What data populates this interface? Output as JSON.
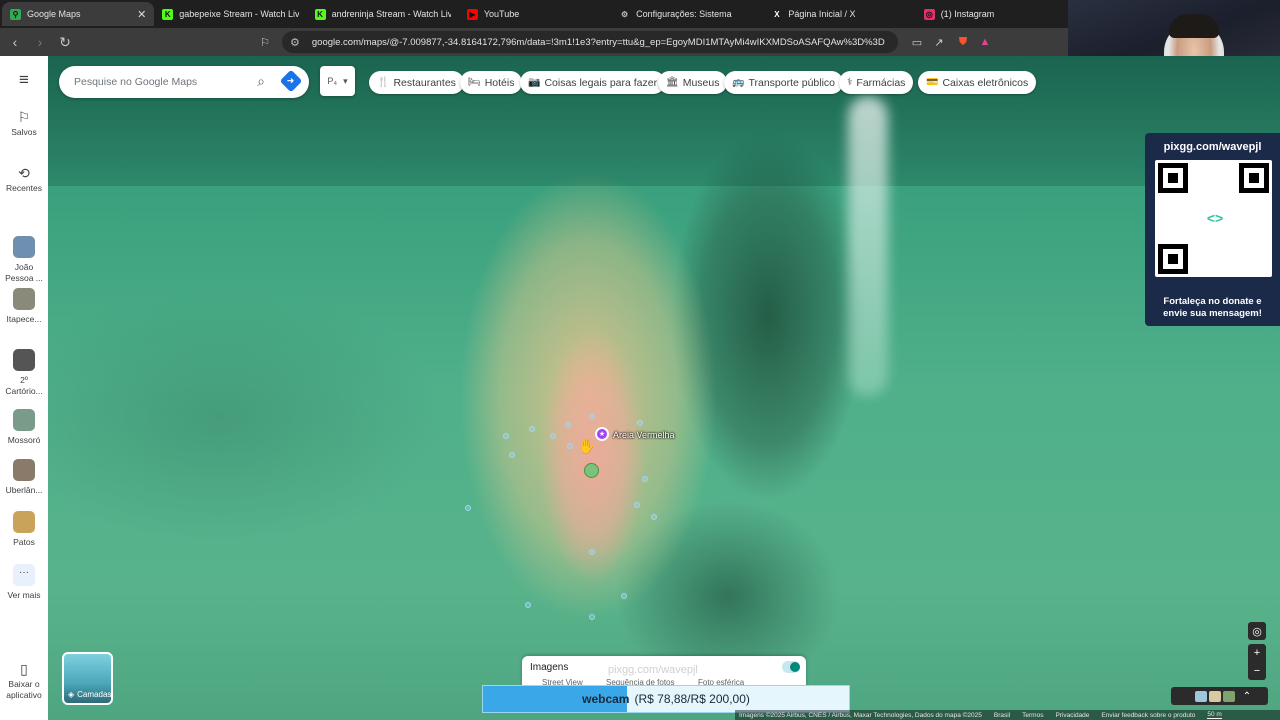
{
  "tabs": [
    {
      "title": "Google Maps",
      "favicon": "google-maps",
      "color": "#34a853",
      "active": true
    },
    {
      "title": "gabepeixe Stream - Watch Live on K",
      "favicon": "kick",
      "color": "#53fc18"
    },
    {
      "title": "andreninja Stream - Watch Live on K",
      "favicon": "kick",
      "color": "#53fc18"
    },
    {
      "title": "YouTube",
      "favicon": "youtube",
      "color": "#ff0000"
    },
    {
      "title": "Configurações: Sistema",
      "favicon": "gear",
      "color": "#bbbbbb"
    },
    {
      "title": "Página Inicial / X",
      "favicon": "x",
      "color": "#ffffff"
    },
    {
      "title": "(1) Instagram",
      "favicon": "instagram",
      "color": "#e1306c"
    }
  ],
  "tab_close_glyph": "✕",
  "url": "google.com/maps/@-7.009877,-34.8164172,796m/data=!3m1!1e3?entry=ttu&g_ep=EgoyMDI1MTAyMi4wIKXMDSoASAFQAw%3D%3D",
  "rail": {
    "menu_icon": "≡",
    "saved": "Salvos",
    "recents": "Recentes",
    "recent_places": [
      {
        "label": "João Pessoa ...",
        "color": "#6f8fb0"
      },
      {
        "label": "Itapece...",
        "color": "#8a8a7a"
      },
      {
        "label": "2º Cartório...",
        "color": "#555555"
      },
      {
        "label": "Mossoró",
        "color": "#7a9a8a"
      },
      {
        "label": "Uberlân...",
        "color": "#8a7a6a"
      },
      {
        "label": "Patos",
        "color": "#c9a35a"
      }
    ],
    "more": "Ver mais",
    "more_glyph": "···",
    "download_app": "Baixar o aplicativo"
  },
  "search": {
    "placeholder": "Pesquise no Google Maps"
  },
  "picker_label": "P₄",
  "chips": [
    {
      "label": "Restaurantes",
      "icon": "🍴"
    },
    {
      "label": "Hotéis",
      "icon": "🛏"
    },
    {
      "label": "Coisas legais para fazer",
      "icon": "📷"
    },
    {
      "label": "Museus",
      "icon": "🏛"
    },
    {
      "label": "Transporte público",
      "icon": "🚌"
    },
    {
      "label": "Farmácias",
      "icon": "⚕"
    },
    {
      "label": "Caixas eletrônicos",
      "icon": "💳"
    }
  ],
  "qr_panel": {
    "url": "pixgg.com/wavepjl",
    "message": "Fortaleça no donate e envie sua mensagem!"
  },
  "place": {
    "name": "Areia Vermelha"
  },
  "images_panel": {
    "title": "Imagens",
    "watermark": "pixgg.com/wavepjl",
    "options": [
      "Street View",
      "Sequência de fotos",
      "Foto esférica"
    ]
  },
  "donation": {
    "label": "webcam",
    "amount": "(R$ 78,88/R$ 200,00)",
    "progress": 0.394
  },
  "layers": {
    "label": "Camadas"
  },
  "footer": {
    "attribution": "Imagens ©2025 Airbus, CNES / Airbus, Maxar Technologies, Dados do mapa ©2025",
    "links": [
      "Brasil",
      "Termos",
      "Privacidade",
      "Enviar feedback sobre o produto"
    ],
    "scale": "50 m"
  }
}
